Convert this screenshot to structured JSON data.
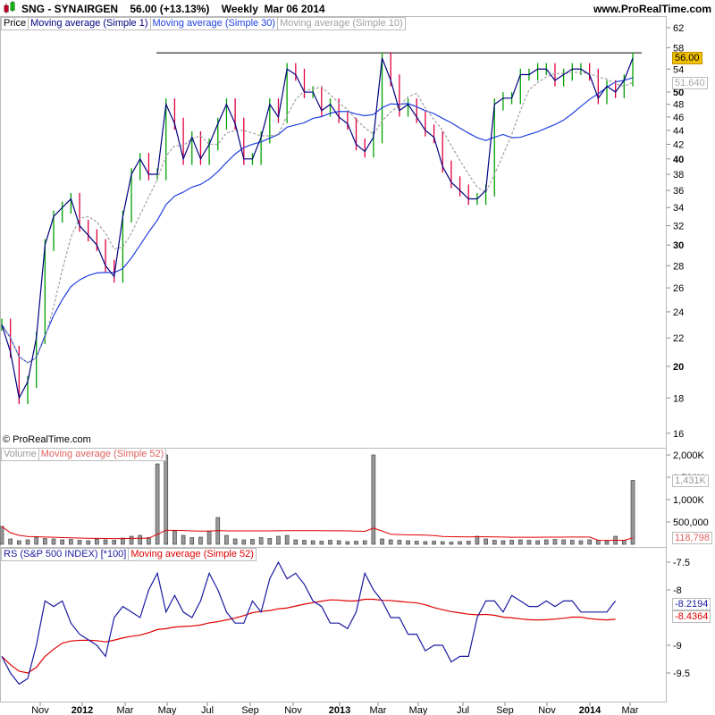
{
  "header": {
    "title": "SNG - SYNAIRGEN    56.00 (+13.13%)    Weekly  Mar 06 2014",
    "url": "www.ProRealTime.com"
  },
  "price_legend": [
    "Price",
    "Moving average (Simple 1)",
    "Moving average (Simple 30)",
    "Moving average (Simple 10)"
  ],
  "volume_legend": [
    "Volume",
    "Moving average (Simple 52)"
  ],
  "rs_legend": [
    "RS (S&P 500 INDEX) [*100]",
    "Moving average (Simple 52)"
  ],
  "copyright": "© ProRealTime.com",
  "tags": {
    "last_price": "56.00",
    "ma30": "51.640",
    "volume": "1,431K",
    "volume_ma": "118,798",
    "rs": "-8.2194",
    "rs_ma": "-8.4364"
  },
  "colors": {
    "up": "#00a000",
    "down": "#e0003c",
    "ma1": "#000080",
    "ma30": "#2040e0",
    "ma10": "#a0a0a0",
    "rs": "#1a1aa0",
    "rs_ma": "#e00000",
    "price_tag": "#f0c000"
  },
  "chart_data": {
    "type": "line",
    "title": "SNG - SYNAIRGEN Weekly",
    "x_ticks": [
      "Nov",
      "2012",
      "Mar",
      "May",
      "Jul",
      "Sep",
      "Nov",
      "2013",
      "Mar",
      "May",
      "Jul",
      "Sep",
      "Nov",
      "2014",
      "Mar"
    ],
    "price": {
      "scale": "log",
      "ylim": [
        15,
        63
      ],
      "ticks": [
        "62",
        "58",
        "54",
        "50",
        "48",
        "46",
        "44",
        "42",
        "40",
        "38",
        "36",
        "34",
        "32",
        "30",
        "28",
        "26",
        "24",
        "22",
        "20",
        "18",
        "16"
      ],
      "resistance_level": 57,
      "close": [
        23,
        21,
        18,
        19,
        22,
        30,
        33,
        34,
        35,
        32,
        31,
        30,
        28,
        27,
        33,
        38,
        40,
        38,
        38,
        48,
        45,
        40,
        43,
        40,
        42,
        45,
        48,
        45,
        40,
        40,
        43,
        48,
        46,
        54,
        53,
        50,
        50,
        47,
        48,
        46,
        45,
        42,
        41,
        43,
        56,
        52,
        47,
        48,
        46,
        44,
        43,
        39,
        37,
        36,
        35,
        35,
        36,
        48,
        49,
        49,
        53,
        53,
        54,
        54,
        52,
        53,
        54,
        54,
        53,
        49,
        51,
        50,
        52,
        56
      ]
    },
    "volume": {
      "ylim": [
        0,
        2000
      ],
      "unit": "K",
      "ticks": [
        "2,000K",
        "1,500K",
        "1,000K",
        "500,000"
      ],
      "values": [
        400,
        120,
        80,
        100,
        150,
        130,
        120,
        100,
        110,
        90,
        80,
        120,
        100,
        90,
        140,
        180,
        200,
        150,
        1800,
        2000,
        300,
        200,
        150,
        160,
        300,
        600,
        200,
        120,
        100,
        110,
        150,
        130,
        180,
        200,
        100,
        90,
        80,
        70,
        90,
        80,
        60,
        70,
        80,
        2000,
        120,
        100,
        90,
        80,
        70,
        60,
        70,
        60,
        50,
        60,
        70,
        180,
        120,
        90,
        80,
        90,
        100,
        90,
        80,
        100,
        110,
        100,
        90,
        80,
        100,
        90,
        80,
        180,
        90,
        1431
      ]
    },
    "rs": {
      "ylim": [
        -9.8,
        -7.3
      ],
      "ticks": [
        "-7.5",
        "-8",
        "-9",
        "-9.5"
      ],
      "values": [
        -9.2,
        -9.5,
        -9.7,
        -9.6,
        -9.0,
        -8.2,
        -8.3,
        -8.2,
        -8.6,
        -8.8,
        -8.9,
        -9.0,
        -9.2,
        -8.5,
        -8.3,
        -8.4,
        -8.5,
        -8.0,
        -7.7,
        -8.4,
        -8.1,
        -8.4,
        -8.5,
        -8.2,
        -7.7,
        -8.0,
        -8.4,
        -8.6,
        -8.6,
        -8.2,
        -8.4,
        -7.8,
        -7.5,
        -7.8,
        -7.7,
        -7.9,
        -8.2,
        -8.3,
        -8.6,
        -8.6,
        -8.7,
        -8.4,
        -7.7,
        -8.0,
        -8.2,
        -8.5,
        -8.5,
        -8.8,
        -8.8,
        -9.1,
        -9.0,
        -9.0,
        -9.3,
        -9.2,
        -9.2,
        -8.5,
        -8.2,
        -8.2,
        -8.4,
        -8.1,
        -8.2,
        -8.3,
        -8.3,
        -8.2,
        -8.3,
        -8.2,
        -8.2,
        -8.4,
        -8.4,
        -8.4,
        -8.4,
        -8.2
      ]
    }
  }
}
